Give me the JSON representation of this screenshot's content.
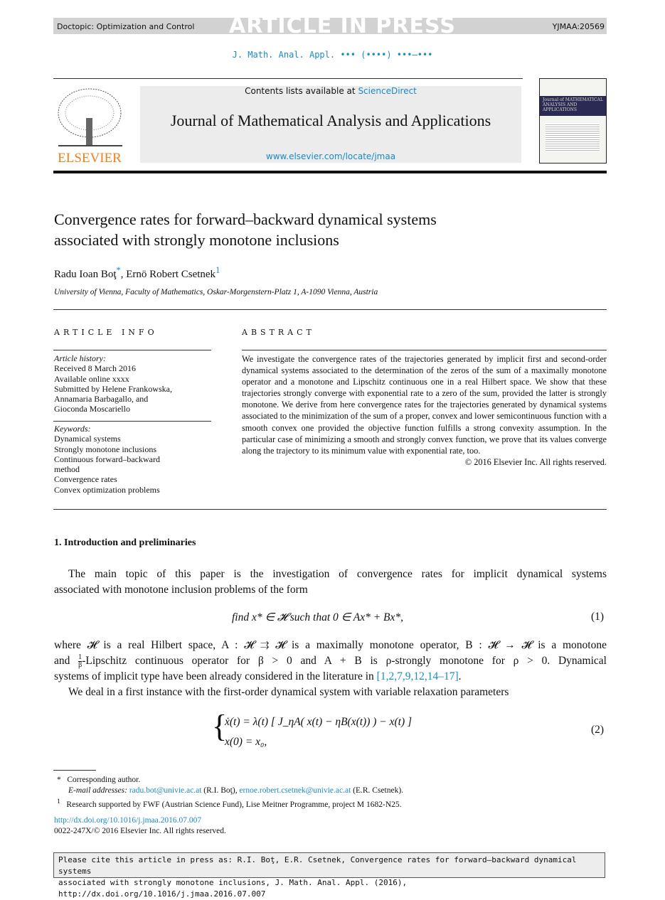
{
  "topbar": {
    "doctopic": "Doctopic: Optimization and Control",
    "stamp": "ARTICLE IN PRESS",
    "id": "YJMAA:20569"
  },
  "running_head": "J. Math. Anal. Appl. ••• (••••) •••–•••",
  "header": {
    "contents_prefix": "Contents lists available at ",
    "sciencedirect": "ScienceDirect",
    "journal": "Journal of Mathematical Analysis and Applications",
    "url": "www.elsevier.com/locate/jmaa",
    "publisher": "ELSEVIER",
    "cover_text": "Journal of MATHEMATICAL ANALYSIS AND APPLICATIONS"
  },
  "colors": {
    "link": "#1a8ac4",
    "elsevier": "#f07f1a",
    "topbar": "#d2d2d2"
  },
  "article": {
    "title_line1": "Convergence rates for forward–backward dynamical systems",
    "title_line2": "associated with strongly monotone inclusions",
    "author1": "Radu Ioan Boţ",
    "author1_mark": "*",
    "author2": "Ernö Robert Csetnek",
    "author2_mark": "1",
    "affiliation": "University of Vienna, Faculty of Mathematics, Oskar-Morgenstern-Platz 1, A-1090 Vienna, Austria"
  },
  "info": {
    "heading": "ARTICLE INFO",
    "history_label": "Article history:",
    "history": [
      "Received 8 March 2016",
      "Available online xxxx",
      "Submitted by Helene Frankowska,",
      "Annamaria Barbagallo, and",
      "Gioconda Moscariello"
    ],
    "keywords_label": "Keywords:",
    "keywords": [
      "Dynamical systems",
      "Strongly monotone inclusions",
      "Continuous forward–backward",
      "method",
      "Convergence rates",
      "Convex optimization problems"
    ]
  },
  "abstract": {
    "heading": "ABSTRACT",
    "text": "We investigate the convergence rates of the trajectories generated by implicit first and second-order dynamical systems associated to the determination of the zeros of the sum of a maximally monotone operator and a monotone and Lipschitz continuous one in a real Hilbert space. We show that these trajectories strongly converge with exponential rate to a zero of the sum, provided the latter is strongly monotone. We derive from here convergence rates for the trajectories generated by dynamical systems associated to the minimization of the sum of a proper, convex and lower semicontinuous function with a smooth convex one provided the objective function fulfills a strong convexity assumption. In the particular case of minimizing a smooth and strongly convex function, we prove that its values converge along the trajectory to its minimum value with exponential rate, too.",
    "copyright": "© 2016 Elsevier Inc. All rights reserved."
  },
  "section": {
    "heading": "1. Introduction and preliminaries",
    "p1_l1": "The main topic of this paper is the investigation of convergence rates for implicit dynamical systems",
    "p1_l2": "associated with monotone inclusion problems of the form",
    "eq1": "find x* ∈ 𝓗 such that 0 ∈ Ax* + Bx*,",
    "eq1_num": "(1)",
    "p2_l1": "where 𝓗 is a real Hilbert space, A : 𝓗 ⇉ 𝓗 is a maximally monotone operator, B : 𝓗 → 𝓗 is a monotone",
    "p2_l2a": "and ",
    "p2_frac_num": "1",
    "p2_frac_den": "β",
    "p2_l2b": "-Lipschitz continuous operator for β > 0 and A + B is ρ-strongly monotone for ρ > 0. Dynamical",
    "p2_l3": "systems of implicit type have been already considered in the literature in ",
    "p2_refs": "[1,2,7,9,12,14–17]",
    "p2_end": ".",
    "p3": "We deal in a first instance with the first-order dynamical system with variable relaxation parameters",
    "eq2_line1": "ẋ(t) = λ(t) [ J_ηA( x(t) − ηB(x(t)) ) − x(t) ]",
    "eq2_line2": "x(0) = x₀,",
    "eq2_num": "(2)"
  },
  "footnotes": {
    "corr_mark": "*",
    "corr": "Corresponding author.",
    "email_label": "E-mail addresses: ",
    "email1": "radu.bot@univie.ac.at",
    "email1_who": " (R.I. Boţ), ",
    "email2": "ernoe.robert.csetnek@univie.ac.at",
    "email2_who": " (E.R. Csetnek).",
    "fn1_mark": "1",
    "fn1": "Research supported by FWF (Austrian Science Fund), Lise Meitner Programme, project M 1682-N25.",
    "doi": "http://dx.doi.org/10.1016/j.jmaa.2016.07.007",
    "issn": "0022-247X/© 2016 Elsevier Inc. All rights reserved."
  },
  "citation": {
    "line1": "Please cite this article in press as: R.I. Boţ, E.R. Csetnek, Convergence rates for forward–backward dynamical systems",
    "line2": "associated with strongly monotone inclusions, J. Math. Anal. Appl. (2016), http://dx.doi.org/10.1016/j.jmaa.2016.07.007"
  }
}
